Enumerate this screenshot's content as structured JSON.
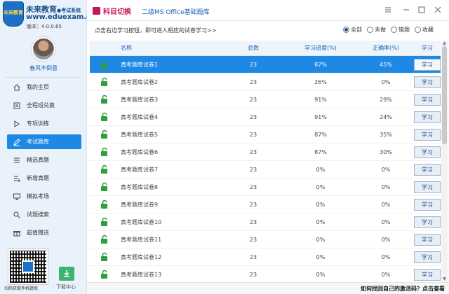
{
  "brand": {
    "title": "未来教育",
    "subtitle": "●考试系统",
    "url": "www.eduexam.cn",
    "version": "版本：4.0.0.65",
    "logo_text": "未来教育"
  },
  "user": {
    "name": "春风不倒意"
  },
  "nav": [
    {
      "label": "我的主页",
      "icon": "home-icon",
      "active": false
    },
    {
      "label": "全程班兑换",
      "icon": "exchange-icon",
      "active": false
    },
    {
      "label": "专项训练",
      "icon": "play-icon",
      "active": false
    },
    {
      "label": "考试题库",
      "icon": "pen-icon",
      "active": true
    },
    {
      "label": "精选真题",
      "icon": "list-icon",
      "active": false
    },
    {
      "label": "新增真题",
      "icon": "list-plus-icon",
      "active": false
    },
    {
      "label": "模拟考场",
      "icon": "monitor-icon",
      "active": false
    },
    {
      "label": "试题搜索",
      "icon": "search-icon",
      "active": false
    },
    {
      "label": "超值赠送",
      "icon": "gift-icon",
      "active": false
    }
  ],
  "qr_caption": "扫码获取手机题库",
  "download_label": "下载中心",
  "topbar": {
    "subject_switch": "科目切换",
    "subject_name": "二级MS Office基础题库"
  },
  "instruction": "点击右边学习按钮，即可进入相应的试卷学习>>",
  "filters": [
    {
      "label": "全部",
      "checked": true
    },
    {
      "label": "未做",
      "checked": false
    },
    {
      "label": "错题",
      "checked": false
    },
    {
      "label": "收藏",
      "checked": false
    }
  ],
  "table": {
    "headers": {
      "name": "名称",
      "total": "总数",
      "progress": "学习进度(%)",
      "accuracy": "正确率(%)",
      "action": "学习"
    },
    "button_label": "学习",
    "rows": [
      {
        "name": "真考题库试卷1",
        "total": "23",
        "progress": "87%",
        "accuracy": "45%",
        "selected": true
      },
      {
        "name": "真考题库试卷2",
        "total": "23",
        "progress": "26%",
        "accuracy": "0%",
        "selected": false
      },
      {
        "name": "真考题库试卷3",
        "total": "23",
        "progress": "91%",
        "accuracy": "29%",
        "selected": false
      },
      {
        "name": "真考题库试卷4",
        "total": "23",
        "progress": "91%",
        "accuracy": "24%",
        "selected": false
      },
      {
        "name": "真考题库试卷5",
        "total": "23",
        "progress": "87%",
        "accuracy": "35%",
        "selected": false
      },
      {
        "name": "真考题库试卷6",
        "total": "23",
        "progress": "87%",
        "accuracy": "30%",
        "selected": false
      },
      {
        "name": "真考题库试卷7",
        "total": "23",
        "progress": "0%",
        "accuracy": "0%",
        "selected": false
      },
      {
        "name": "真考题库试卷8",
        "total": "23",
        "progress": "0%",
        "accuracy": "0%",
        "selected": false
      },
      {
        "name": "真考题库试卷9",
        "total": "23",
        "progress": "0%",
        "accuracy": "0%",
        "selected": false
      },
      {
        "name": "真考题库试卷10",
        "total": "23",
        "progress": "0%",
        "accuracy": "0%",
        "selected": false
      },
      {
        "name": "真考题库试卷11",
        "total": "23",
        "progress": "0%",
        "accuracy": "0%",
        "selected": false
      },
      {
        "name": "真考题库试卷12",
        "total": "23",
        "progress": "0%",
        "accuracy": "0%",
        "selected": false
      },
      {
        "name": "真考题库试卷13",
        "total": "23",
        "progress": "0%",
        "accuracy": "0%",
        "selected": false
      }
    ]
  },
  "status": {
    "activation_text": "如何找回自己的激活码？点击查看"
  },
  "colors": {
    "accent": "#1e88e5",
    "lock_green": "#2e9e3e",
    "subject_red": "#c2185b"
  }
}
